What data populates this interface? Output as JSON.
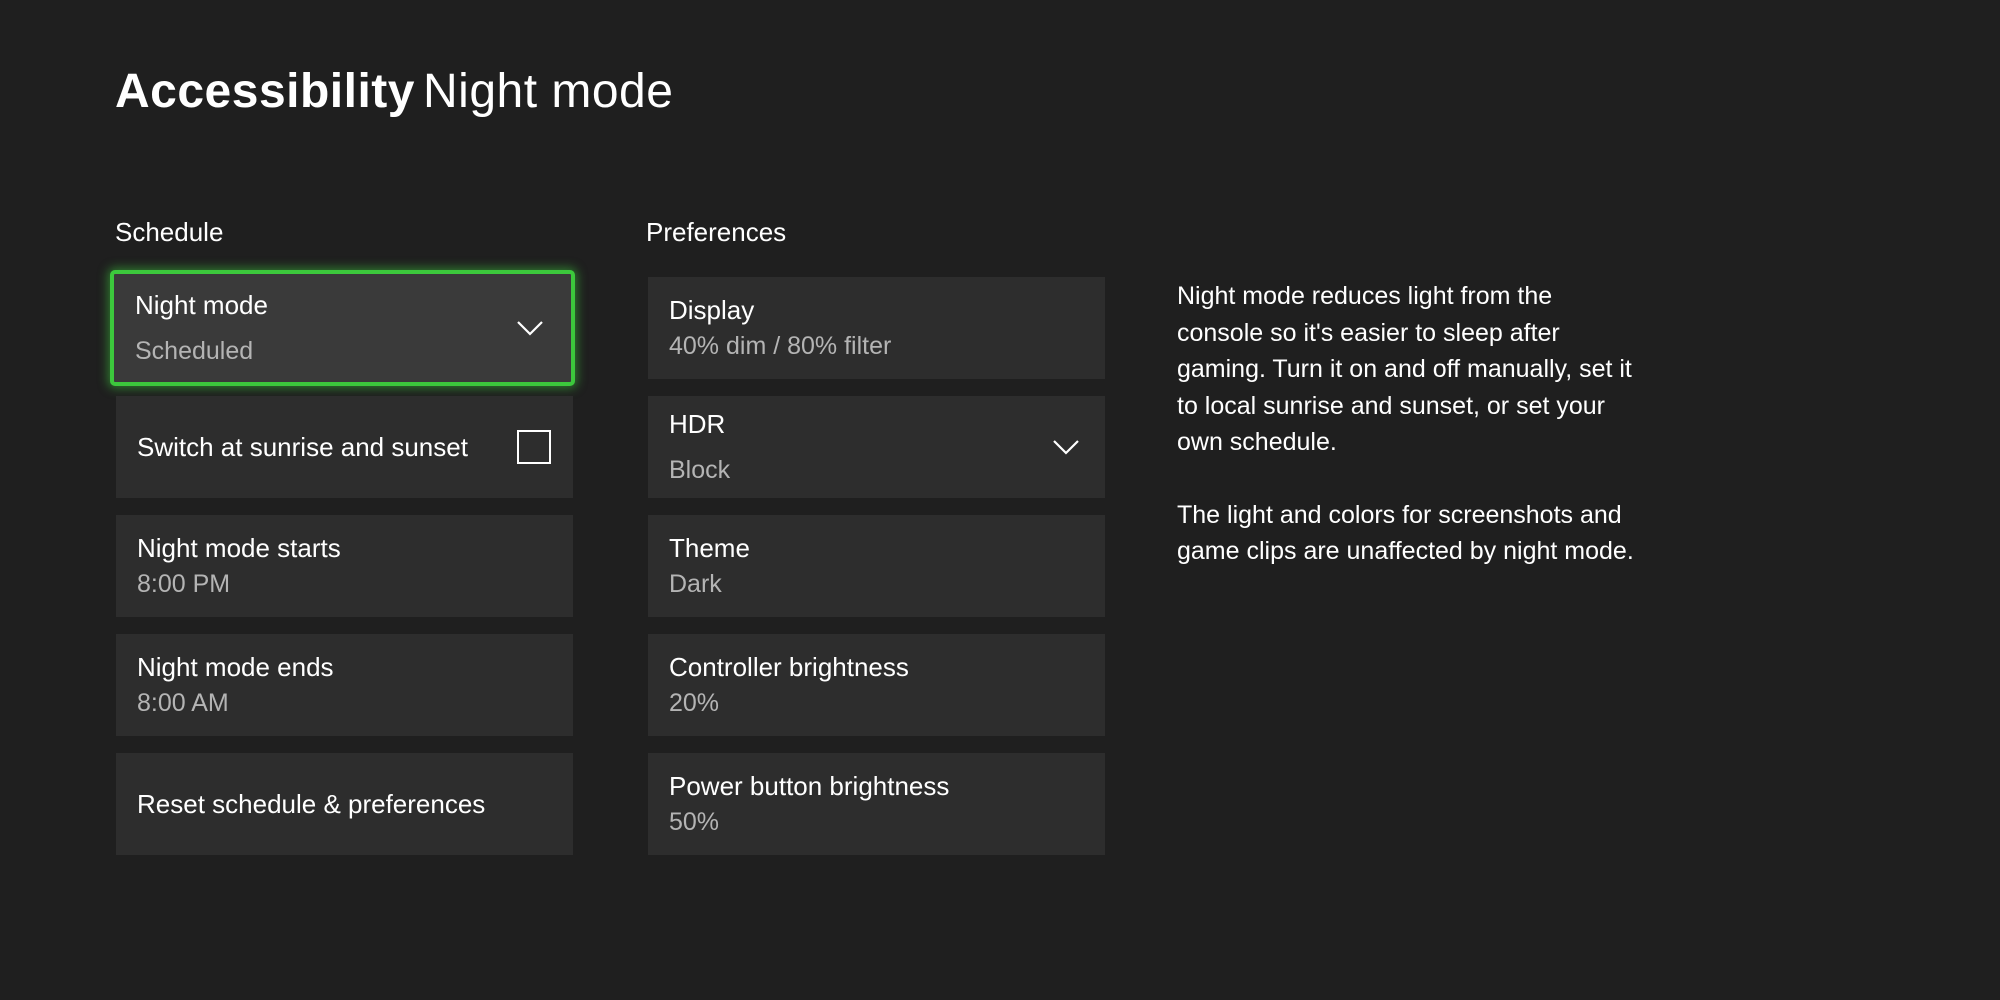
{
  "header": {
    "section": "Accessibility",
    "page": "Night mode"
  },
  "schedule": {
    "heading": "Schedule",
    "night_mode": {
      "label": "Night mode",
      "value": "Scheduled"
    },
    "sunrise_sunset": {
      "label": "Switch at sunrise and sunset",
      "checked": false
    },
    "starts": {
      "label": "Night mode starts",
      "value": "8:00 PM"
    },
    "ends": {
      "label": "Night mode ends",
      "value": "8:00 AM"
    },
    "reset": {
      "label": "Reset schedule & preferences"
    }
  },
  "preferences": {
    "heading": "Preferences",
    "display": {
      "label": "Display",
      "value": "40% dim / 80% filter"
    },
    "hdr": {
      "label": "HDR",
      "value": "Block"
    },
    "theme": {
      "label": "Theme",
      "value": "Dark"
    },
    "controller_brightness": {
      "label": "Controller brightness",
      "value": "20%"
    },
    "power_button_brightness": {
      "label": "Power button brightness",
      "value": "50%"
    }
  },
  "description": {
    "paragraph1": "Night mode reduces light from the console so it's easier to sleep after gaming. Turn it on and off manually, set it to local sunrise and sunset, or set your own schedule.",
    "paragraph2": "The light and colors for screenshots and game clips are unaffected by night mode."
  },
  "colors": {
    "background": "#1f1f1f",
    "tile": "#2d2d2d",
    "focus": "#3cc83c",
    "secondary_text": "#b4b4b4"
  }
}
